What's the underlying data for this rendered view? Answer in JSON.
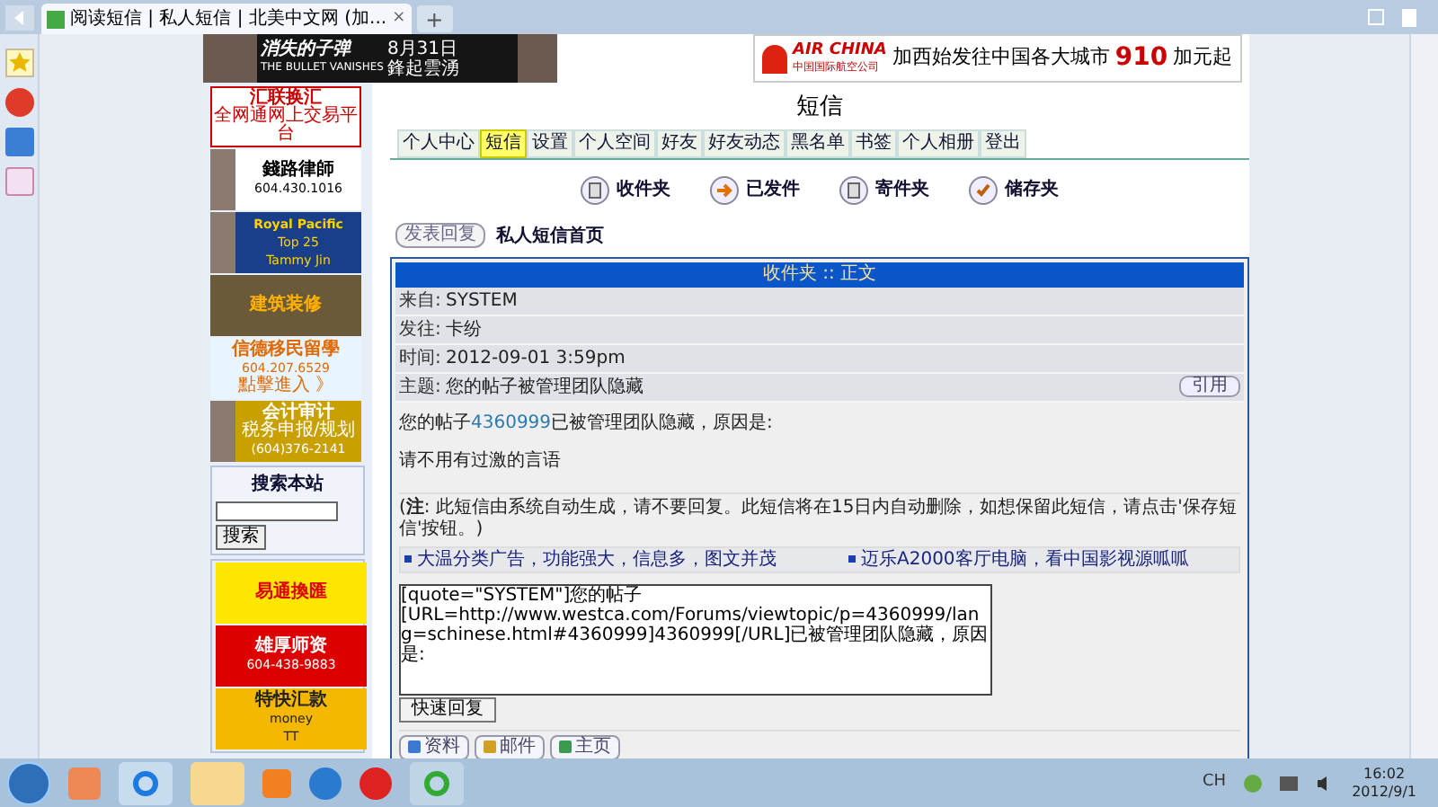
{
  "browser": {
    "tab_title": "阅读短信 | 私人短信 | 北美中文网 (加...",
    "tab_close": "×",
    "new_tab": "+"
  },
  "top_banners": [
    {
      "kind": "movie",
      "lines": [
        "消失的子弹",
        "THE BULLET VANISHES",
        "8月31日",
        "鋒起雲湧"
      ]
    },
    {
      "kind": "airline",
      "lines": [
        "AIR CHINA",
        "中国国际航空公司",
        "加西始发往中国各大城市",
        "910",
        "加元起"
      ]
    }
  ],
  "side_ads": [
    {
      "kind": "fx",
      "photo": false,
      "lines": [
        "汇联换汇",
        "全网通网上交易平台"
      ]
    },
    {
      "kind": "lawyer",
      "photo": true,
      "lines": [
        "錢路律師",
        "604.430.1016"
      ]
    },
    {
      "kind": "realty",
      "photo": true,
      "lines": [
        "Royal Pacific",
        "Top 25",
        "Tammy Jin"
      ]
    },
    {
      "kind": "reno",
      "photo": false,
      "lines": [
        "建筑装修"
      ]
    },
    {
      "kind": "immigration",
      "photo": false,
      "lines": [
        "信德移民留學",
        "604.207.6529",
        "點擊進入 》"
      ]
    },
    {
      "kind": "account",
      "photo": true,
      "lines": [
        "会计审计",
        "税务申报/规划",
        "(604)376-2141"
      ]
    }
  ],
  "search": {
    "title": "搜索本站",
    "button": "搜索"
  },
  "side_ads_2": [
    {
      "kind": "exchange",
      "photo": false,
      "lines": [
        "易通換匯"
      ]
    },
    {
      "kind": "school",
      "photo": false,
      "lines": [
        "雄厚师资",
        "604-438-9883"
      ]
    },
    {
      "kind": "tt",
      "photo": false,
      "lines": [
        "特快汇款",
        "money",
        "TT"
      ]
    }
  ],
  "page_title": "短信",
  "tabs": [
    {
      "label": "个人中心",
      "selected": false
    },
    {
      "label": "短信",
      "selected": true
    },
    {
      "label": "设置",
      "selected": false
    },
    {
      "label": "个人空间",
      "selected": false
    },
    {
      "label": "好友",
      "selected": false
    },
    {
      "label": "好友动态",
      "selected": false
    },
    {
      "label": "黑名单",
      "selected": false
    },
    {
      "label": "书签",
      "selected": false
    },
    {
      "label": "个人相册",
      "selected": false
    },
    {
      "label": "登出",
      "selected": false
    }
  ],
  "folders": [
    {
      "kind": "inbox",
      "label": "收件夹"
    },
    {
      "kind": "sent",
      "label": "已发件"
    },
    {
      "kind": "outbox",
      "label": "寄件夹"
    },
    {
      "kind": "saved",
      "label": "储存夹"
    }
  ],
  "reply_button": "发表回复",
  "breadcrumb": "私人短信首页",
  "message": {
    "header": "收件夹 :: 正文",
    "fields": [
      {
        "label": "来自:",
        "value": "SYSTEM"
      },
      {
        "label": "发往:",
        "value": "卡纷"
      },
      {
        "label": "时间:",
        "value": "2012-09-01 3:59pm"
      },
      {
        "label": "主题:",
        "value": "您的帖子被管理团队隐藏"
      }
    ],
    "quote_button": "引用",
    "body_before": "您的帖子",
    "body_link": "4360999",
    "body_after": "已被管理团队隐藏，原因是:",
    "reason": "请不用有过激的言语",
    "note": "(**注**: 此短信由系统自动生成，请不要回复。此短信将在15日内自动删除，如想保留此短信，请点击'保存短信'按钮。)",
    "ads": [
      "大温分类广告，功能强大，信息多，图文并茂",
      "迈乐A2000客厅电脑，看中国影视源呱呱"
    ],
    "reply_value": "[quote=\"SYSTEM\"]您的帖子\n[URL=http://www.westca.com/Forums/viewtopic/p=4360999/lang=schinese.html#4360999]4360999[/URL]已被管理团队隐藏，原因是:",
    "quick_reply": "快速回复",
    "profile_buttons": [
      {
        "kind": "profile",
        "label": "资料"
      },
      {
        "kind": "email",
        "label": "邮件"
      },
      {
        "kind": "home",
        "label": "主页"
      }
    ]
  },
  "taskbar": {
    "lang": "CH",
    "time": "16:02",
    "date": "2012/9/1"
  }
}
